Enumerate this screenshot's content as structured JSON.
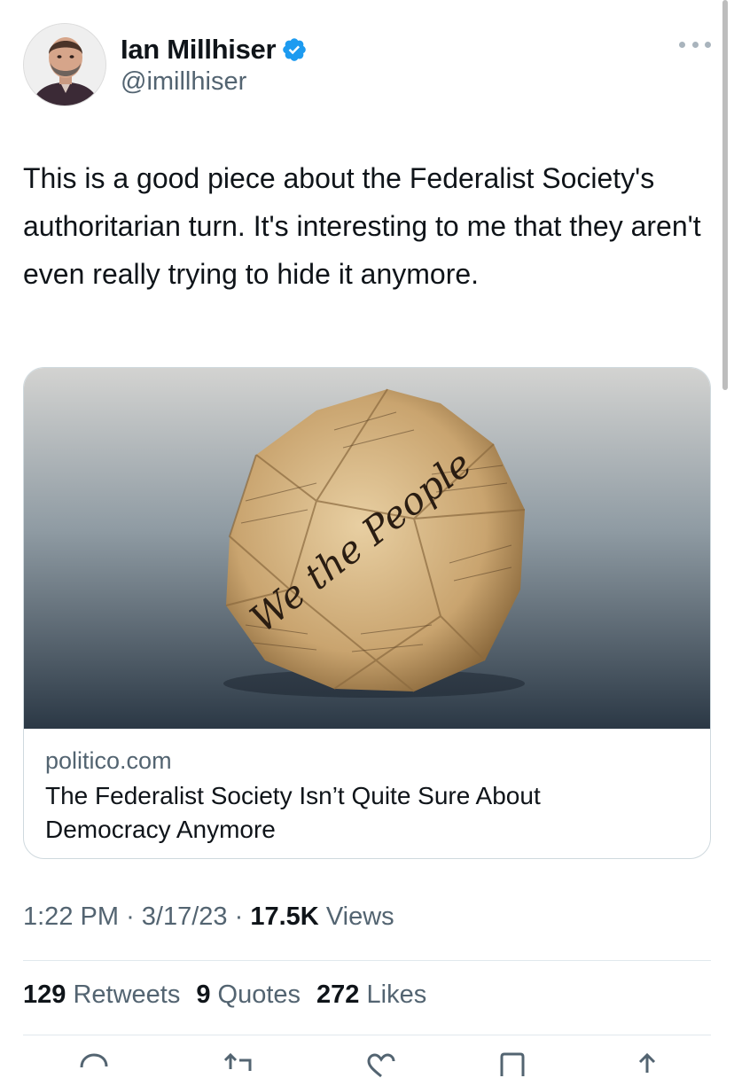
{
  "user": {
    "display_name": "Ian Millhiser",
    "handle": "@imillhiser",
    "verified_icon": "verified-badge-icon",
    "avatar": "profile-photo"
  },
  "tweet": {
    "text": "This is a good piece about the Federalist Society's authoritarian turn. It's interesting to me that they aren't even really trying to hide it anymore."
  },
  "card": {
    "image": "crumpled-constitution-paper",
    "image_text": "We the People",
    "domain": "politico.com",
    "title": "The Federalist Society Isn’t Quite Sure About Democracy Anymore"
  },
  "meta": {
    "time": "1:22 PM",
    "separator": "·",
    "date": "3/17/23",
    "views_count": "17.5K",
    "views_label": "Views"
  },
  "stats": {
    "retweets_count": "129",
    "retweets_label": "Retweets",
    "quotes_count": "9",
    "quotes_label": "Quotes",
    "likes_count": "272",
    "likes_label": "Likes"
  },
  "actions": [
    "reply-icon",
    "retweet-icon",
    "like-icon",
    "bookmark-icon",
    "share-icon"
  ],
  "colors": {
    "verified": "#1d9bf0",
    "secondary_text": "#536471",
    "primary_text": "#0f1419",
    "border": "#cfd9de"
  }
}
